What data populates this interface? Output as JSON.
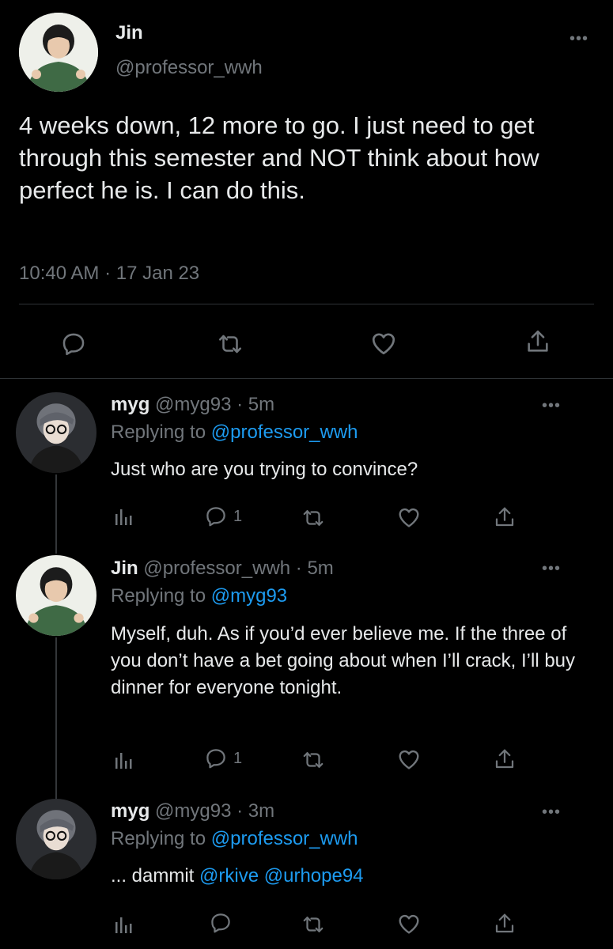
{
  "main_tweet": {
    "name": "Jin",
    "handle": "@professor_wwh",
    "text": "4 weeks down, 12 more to go. I just need to get through this semester and NOT think about how perfect he is. I can do this.",
    "timestamp": "10:40 AM · 17 Jan 23",
    "more": "•••",
    "actions": [
      "reply-icon",
      "retweet-icon",
      "like-icon",
      "share-icon"
    ]
  },
  "replies": [
    {
      "name": "myg",
      "handle_time": "@myg93 · 5m",
      "replying_prefix": "Replying to",
      "replying_to": "@professor_wwh",
      "text": "Just who are you trying to convince?",
      "reply_count": "1",
      "more": "•••"
    },
    {
      "name": "Jin",
      "handle_time": "@professor_wwh · 5m",
      "replying_prefix": "Replying to",
      "replying_to": "@myg93",
      "text": "Myself, duh. As if you’d ever believe me. If the three of you don’t have a bet going about when I’ll crack, I’ll buy dinner for everyone tonight.",
      "reply_count": "1",
      "more": "•••"
    },
    {
      "name": "myg",
      "handle_time": "@myg93 · 3m",
      "replying_prefix": "Replying to",
      "replying_to": "@professor_wwh",
      "text_prefix": "... dammit",
      "mentions": "@rkive @urhope94",
      "reply_count": "",
      "more": "•••"
    }
  ],
  "colors": {
    "background": "#000000",
    "text": "#e7e9ea",
    "secondary": "#71767b",
    "link": "#1d9bf0",
    "divider": "#2f3336"
  }
}
